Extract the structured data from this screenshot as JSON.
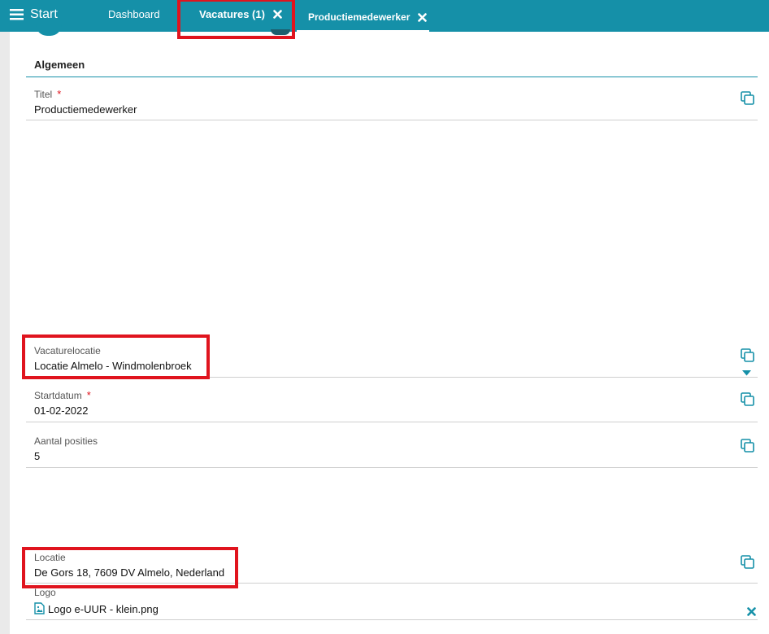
{
  "topbar": {
    "menu_label": "Start",
    "tabs": [
      {
        "label": "Dashboard"
      },
      {
        "label": "Vacatures (1)"
      },
      {
        "label": "Productiemedewerker"
      }
    ]
  },
  "section": {
    "title": "Algemeen"
  },
  "fields": {
    "titel": {
      "label": "Titel",
      "required_mark": "*",
      "value": "Productiemedewerker"
    },
    "vacaturelocatie": {
      "label": "Vacaturelocatie",
      "value": "Locatie Almelo - Windmolenbroek"
    },
    "startdatum": {
      "label": "Startdatum",
      "required_mark": "*",
      "value": "01-02-2022"
    },
    "aantal_posities": {
      "label": "Aantal posities",
      "value": "5"
    },
    "locatie": {
      "label": "Locatie",
      "value": "De Gors 18, 7609 DV Almelo, Nederland"
    },
    "logo": {
      "label": "Logo",
      "value": "Logo e-UUR - klein.png"
    }
  },
  "colors": {
    "accent": "#1590a8",
    "highlight": "#e0141e",
    "required": "#e0141e"
  }
}
